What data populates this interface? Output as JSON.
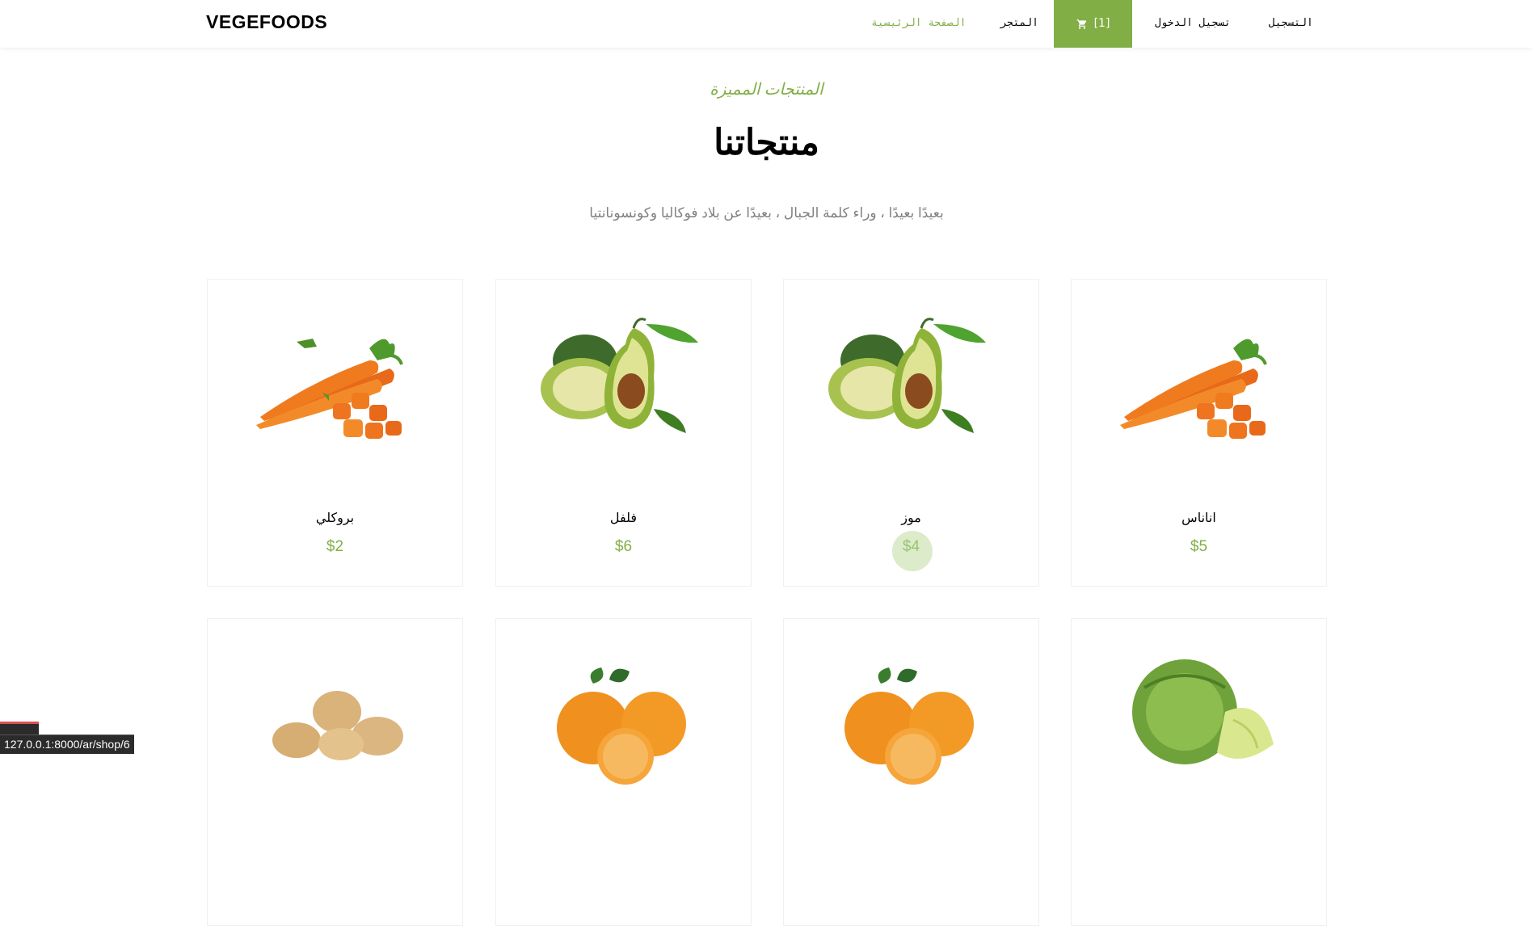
{
  "brand": "VEGEFOODS",
  "nav": {
    "home": "الصفحة الرئيسية",
    "shop": "المتجر",
    "cart_count": "[1]",
    "login": "تسجيل الدخول",
    "register": "التسجيل"
  },
  "section": {
    "subheading": "المنتجات المميزة",
    "heading": "منتجاتنا",
    "lead": "بعيدًا بعيدًا ، وراء كلمة الجبال ، بعيدًا عن بلاد فوكاليا وكونسونانتيا"
  },
  "products": [
    {
      "name": "بروكلي",
      "price": "$2",
      "image": "carrots"
    },
    {
      "name": "فلفل",
      "price": "$6",
      "image": "avocado"
    },
    {
      "name": "موز",
      "price": "$4",
      "image": "avocado"
    },
    {
      "name": "اناناس",
      "price": "$5",
      "image": "carrots"
    },
    {
      "image": "potatoes"
    },
    {
      "image": "oranges"
    },
    {
      "image": "oranges"
    },
    {
      "image": "cabbage"
    }
  ],
  "statusbar": {
    "url": "127.0.0.1:8000/ar/shop/6"
  },
  "colors": {
    "accent": "#82ae46",
    "text": "#000000",
    "muted": "#808080"
  },
  "icons": {
    "cart": "cart-icon"
  }
}
